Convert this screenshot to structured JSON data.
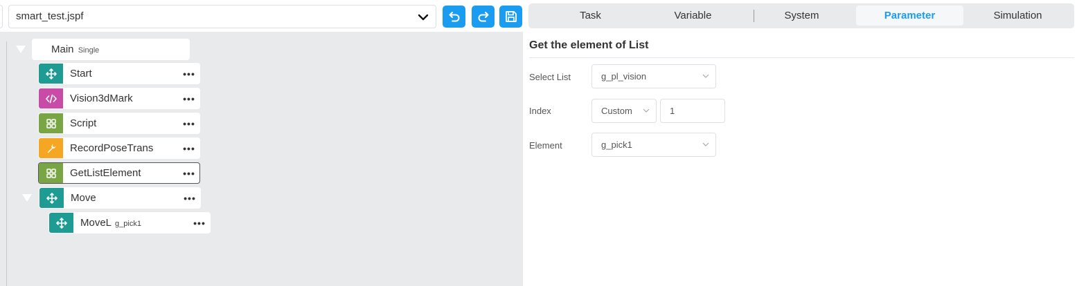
{
  "file": {
    "name": "smart_test.jspf",
    "icons": {
      "dropdown": "chevron-down-icon",
      "undo": "undo-icon",
      "redo": "redo-icon",
      "save": "save-icon"
    }
  },
  "colors": {
    "accent": "#1a9cf0",
    "move": "#1e9b92",
    "code": "#c94ba8",
    "script": "#7aa544",
    "tool": "#f5a623"
  },
  "tree": {
    "main": {
      "label": "Main",
      "sub": "Single"
    },
    "nodes": [
      {
        "label": "Start",
        "sub": "",
        "icon": "move-arrows-icon"
      },
      {
        "label": "Vision3dMark",
        "sub": "",
        "icon": "code-icon"
      },
      {
        "label": "Script",
        "sub": "",
        "icon": "grid-icon"
      },
      {
        "label": "RecordPoseTrans",
        "sub": "",
        "icon": "wrench-icon"
      },
      {
        "label": "GetListElement",
        "sub": "",
        "icon": "grid-icon"
      },
      {
        "label": "Move",
        "sub": "",
        "icon": "move-arrows-icon"
      },
      {
        "label": "MoveL",
        "sub": "g_pick1",
        "icon": "move-arrows-icon"
      }
    ],
    "more_label": "•••"
  },
  "tabs": [
    "Task",
    "Variable",
    "System",
    "Parameter",
    "Simulation"
  ],
  "active_tab": "Parameter",
  "panel": {
    "title": "Get the element of List",
    "select_list": {
      "label": "Select List",
      "value": "g_pl_vision"
    },
    "index": {
      "label": "Index",
      "mode": "Custom",
      "value": "1"
    },
    "element": {
      "label": "Element",
      "value": "g_pick1"
    }
  }
}
